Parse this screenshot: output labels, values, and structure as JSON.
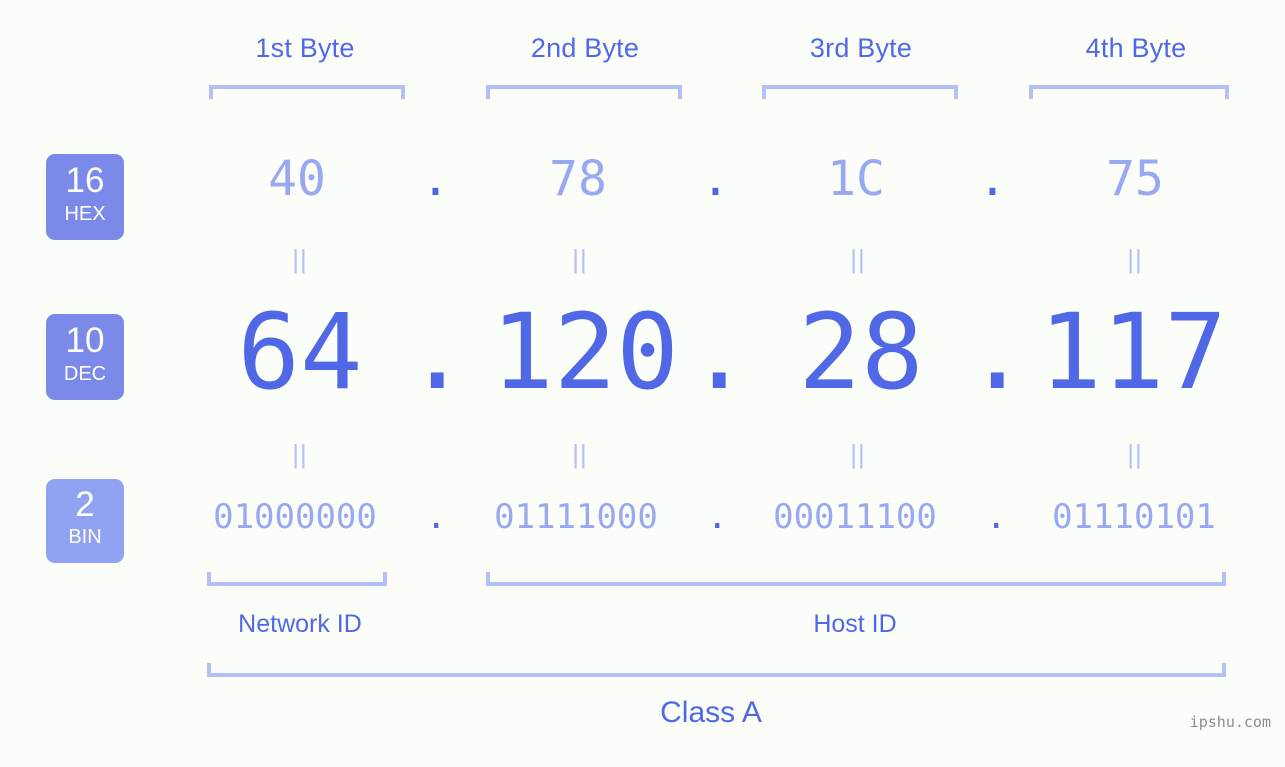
{
  "background_color": "#fbfdf8",
  "accent_color": "#5168e6",
  "muted_accent_color": "#9aa8f2",
  "bracket_color": "#b5bff7",
  "badge_color": "#7b8ae9",
  "badge_color_bin": "#90a3f2",
  "byte_headers": [
    {
      "label": "1st Byte"
    },
    {
      "label": "2nd Byte"
    },
    {
      "label": "3rd Byte"
    },
    {
      "label": "4th Byte"
    }
  ],
  "rows": {
    "hex": {
      "badge_number": "16",
      "badge_abbr": "HEX",
      "values": [
        "40",
        "78",
        "1C",
        "75"
      ],
      "separator": "."
    },
    "dec": {
      "badge_number": "10",
      "badge_abbr": "DEC",
      "values": [
        "64",
        "120",
        "28",
        "117"
      ],
      "separator": "."
    },
    "bin": {
      "badge_number": "2",
      "badge_abbr": "BIN",
      "values": [
        "01000000",
        "01111000",
        "00011100",
        "01110101"
      ],
      "separator": "."
    }
  },
  "equality_marker": "||",
  "segments": {
    "network_id_label": "Network ID",
    "host_id_label": "Host ID"
  },
  "class_label": "Class A",
  "watermark": "ipshu.com",
  "chart_data": {
    "type": "table",
    "title": "IP Address Byte Breakdown",
    "ip_address": "64.120.28.117",
    "categories": [
      "1st Byte",
      "2nd Byte",
      "3rd Byte",
      "4th Byte"
    ],
    "series": [
      {
        "name": "HEX (base 16)",
        "values": [
          "40",
          "78",
          "1C",
          "75"
        ]
      },
      {
        "name": "DEC (base 10)",
        "values": [
          64,
          120,
          28,
          117
        ]
      },
      {
        "name": "BIN (base 2)",
        "values": [
          "01000000",
          "01111000",
          "00011100",
          "01110101"
        ]
      }
    ],
    "network_id_bytes": [
      "1st Byte"
    ],
    "host_id_bytes": [
      "2nd Byte",
      "3rd Byte",
      "4th Byte"
    ],
    "ip_class": "Class A"
  }
}
